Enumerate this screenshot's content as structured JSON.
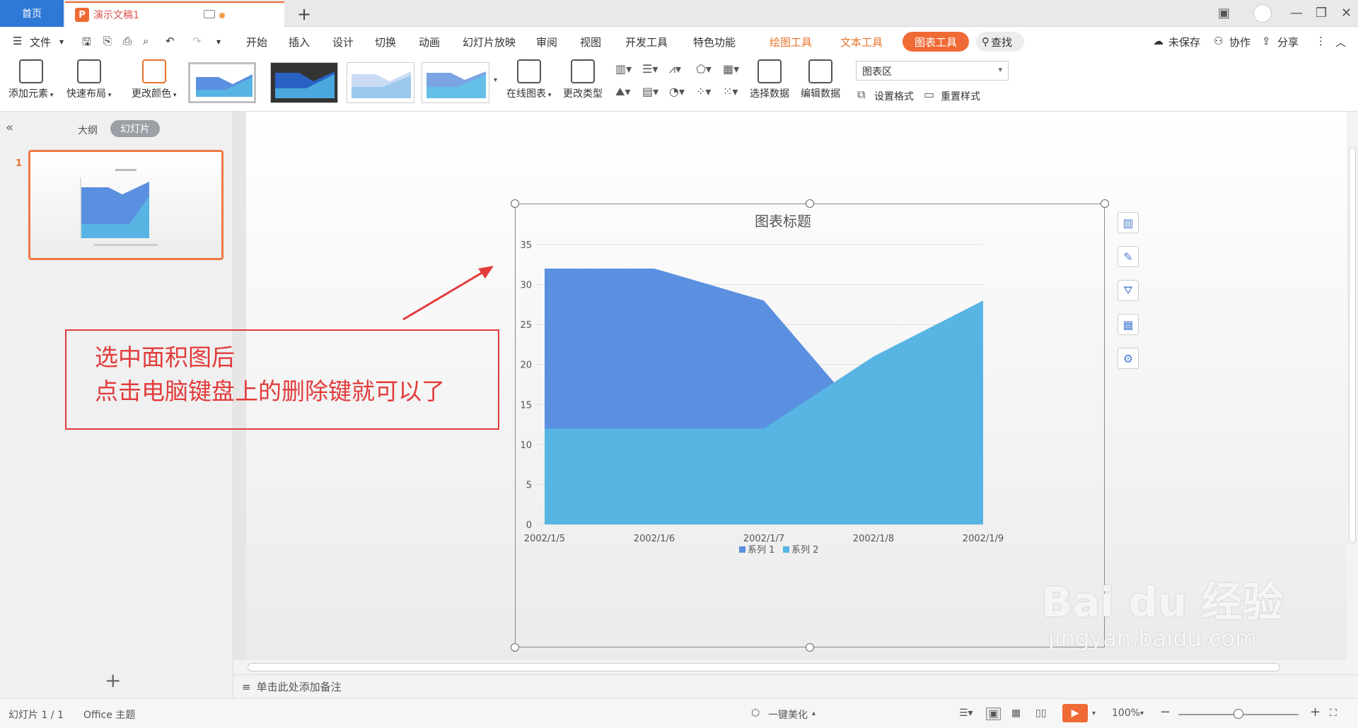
{
  "titlebar": {
    "home_tab": "首页",
    "doc_tab": "演示文稿1",
    "doc_badge": "P",
    "add_tab": "+"
  },
  "menubar": {
    "file": "文件",
    "items": [
      "开始",
      "插入",
      "设计",
      "切换",
      "动画",
      "幻灯片放映",
      "审阅",
      "视图",
      "开发工具",
      "特色功能"
    ],
    "tool_tabs": [
      "绘图工具",
      "文本工具"
    ],
    "active_tab": "图表工具",
    "search": "查找",
    "unsaved": "未保存",
    "collab": "协作",
    "share": "分享"
  },
  "ribbon": {
    "add_element": "添加元素",
    "quick_layout": "快速布局",
    "change_color": "更改颜色",
    "online_chart": "在线图表",
    "change_type": "更改类型",
    "select_data": "选择数据",
    "edit_data": "编辑数据",
    "chart_area": "图表区",
    "set_format": "设置格式",
    "reset_style": "重置样式"
  },
  "leftpanel": {
    "outline": "大纲",
    "slides": "幻灯片",
    "slide_number": "1",
    "add": "+"
  },
  "annotation": {
    "line1": "选中面积图后",
    "line2": "点击电脑键盘上的删除键就可以了"
  },
  "notes": {
    "placeholder": "单击此处添加备注"
  },
  "statusbar": {
    "slide_info": "幻灯片 1 / 1",
    "theme": "Office 主题",
    "beautify": "一键美化",
    "zoom": "100%"
  },
  "watermark": {
    "brand": "Bai du 经验",
    "url": "jingyan.baidu.com"
  },
  "colors": {
    "series1": "#5b8fe0",
    "series2": "#58b4e3",
    "accent": "#f06a35",
    "annotation": "#e33b3b"
  },
  "chart_data": {
    "type": "area",
    "title": "图表标题",
    "categories": [
      "2002/1/5",
      "2002/1/6",
      "2002/1/7",
      "2002/1/8",
      "2002/1/9"
    ],
    "series": [
      {
        "name": "系列 1",
        "values": [
          32,
          32,
          28,
          12,
          15
        ]
      },
      {
        "name": "系列 2",
        "values": [
          12,
          12,
          12,
          21,
          28
        ]
      }
    ],
    "yticks": [
      "0",
      "5",
      "10",
      "15",
      "20",
      "25",
      "30",
      "35"
    ],
    "ylim": [
      0,
      35
    ],
    "grid": true,
    "legend": "bottom"
  }
}
